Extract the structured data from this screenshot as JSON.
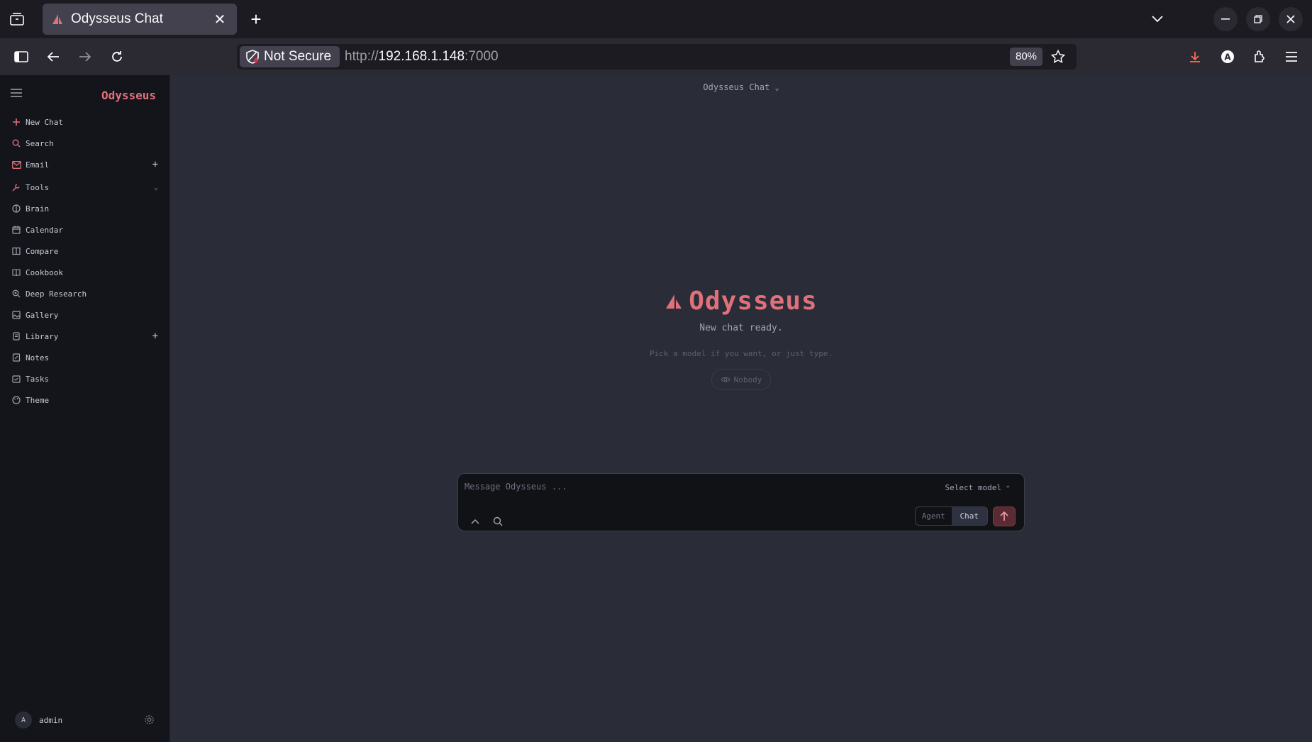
{
  "browser": {
    "tab_title": "Odysseus Chat",
    "security_label": "Not Secure",
    "url_scheme": "http://",
    "url_host": "192.168.1.148",
    "url_port": ":7000",
    "zoom": "80%"
  },
  "sidebar": {
    "brand": "Odysseus",
    "items": [
      {
        "label": "New Chat",
        "icon": "plus-icon"
      },
      {
        "label": "Search",
        "icon": "search-icon"
      },
      {
        "label": "Email",
        "icon": "mail-icon",
        "trail": "+"
      },
      {
        "label": "Tools",
        "icon": "wrench-icon",
        "trail": "⌄"
      },
      {
        "label": "Brain",
        "icon": "brain-icon"
      },
      {
        "label": "Calendar",
        "icon": "calendar-icon"
      },
      {
        "label": "Compare",
        "icon": "columns-icon"
      },
      {
        "label": "Cookbook",
        "icon": "book-icon"
      },
      {
        "label": "Deep Research",
        "icon": "zoom-icon"
      },
      {
        "label": "Gallery",
        "icon": "image-icon"
      },
      {
        "label": "Library",
        "icon": "library-icon",
        "trail": "+"
      },
      {
        "label": "Notes",
        "icon": "note-icon"
      },
      {
        "label": "Tasks",
        "icon": "tasks-icon"
      },
      {
        "label": "Theme",
        "icon": "palette-icon"
      }
    ],
    "user": {
      "initial": "A",
      "name": "admin"
    }
  },
  "main": {
    "model_header": "Odysseus Chat",
    "hero_title": "Odysseus",
    "hero_subtitle": "New chat ready.",
    "hero_hint": "Pick a model if you want, or just type.",
    "visibility": "Nobody"
  },
  "composer": {
    "placeholder": "Message Odysseus ...",
    "select_model": "Select model",
    "modes": [
      "Agent",
      "Chat"
    ],
    "active_mode": "Chat"
  },
  "colors": {
    "accent": "#e0707a",
    "app_bg": "#2a2d38",
    "sidebar_bg": "#14151a"
  }
}
